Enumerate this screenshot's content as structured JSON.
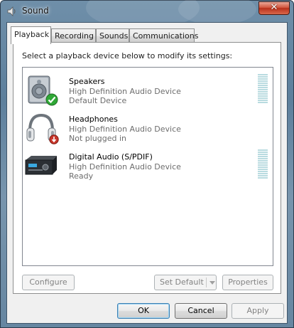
{
  "window": {
    "title": "Sound",
    "close_glyph": "✕"
  },
  "tabs": [
    {
      "label": "Playback",
      "active": true
    },
    {
      "label": "Recording",
      "active": false
    },
    {
      "label": "Sounds",
      "active": false
    },
    {
      "label": "Communications",
      "active": false
    }
  ],
  "panel": {
    "instruction": "Select a playback device below to modify its settings:"
  },
  "devices": [
    {
      "name": "Speakers",
      "description": "High Definition Audio Device",
      "status": "Default Device",
      "icon": "speaker-icon",
      "badge": "default-check-icon",
      "meter_visible": true
    },
    {
      "name": "Headphones",
      "description": "High Definition Audio Device",
      "status": "Not plugged in",
      "icon": "headphones-icon",
      "badge": "unplugged-arrow-icon",
      "meter_visible": false
    },
    {
      "name": "Digital Audio (S/PDIF)",
      "description": "High Definition Audio Device",
      "status": "Ready",
      "icon": "digital-audio-receiver-icon",
      "badge": null,
      "meter_visible": true
    }
  ],
  "panel_buttons": {
    "configure": "Configure",
    "set_default": "Set Default",
    "properties": "Properties"
  },
  "dialog_buttons": {
    "ok": "OK",
    "cancel": "Cancel",
    "apply": "Apply"
  },
  "colors": {
    "glass": "#6f8fa9",
    "meter_segment": "#b9dbe0",
    "check_green": "#2fa836",
    "unplug_red": "#c8352a"
  }
}
